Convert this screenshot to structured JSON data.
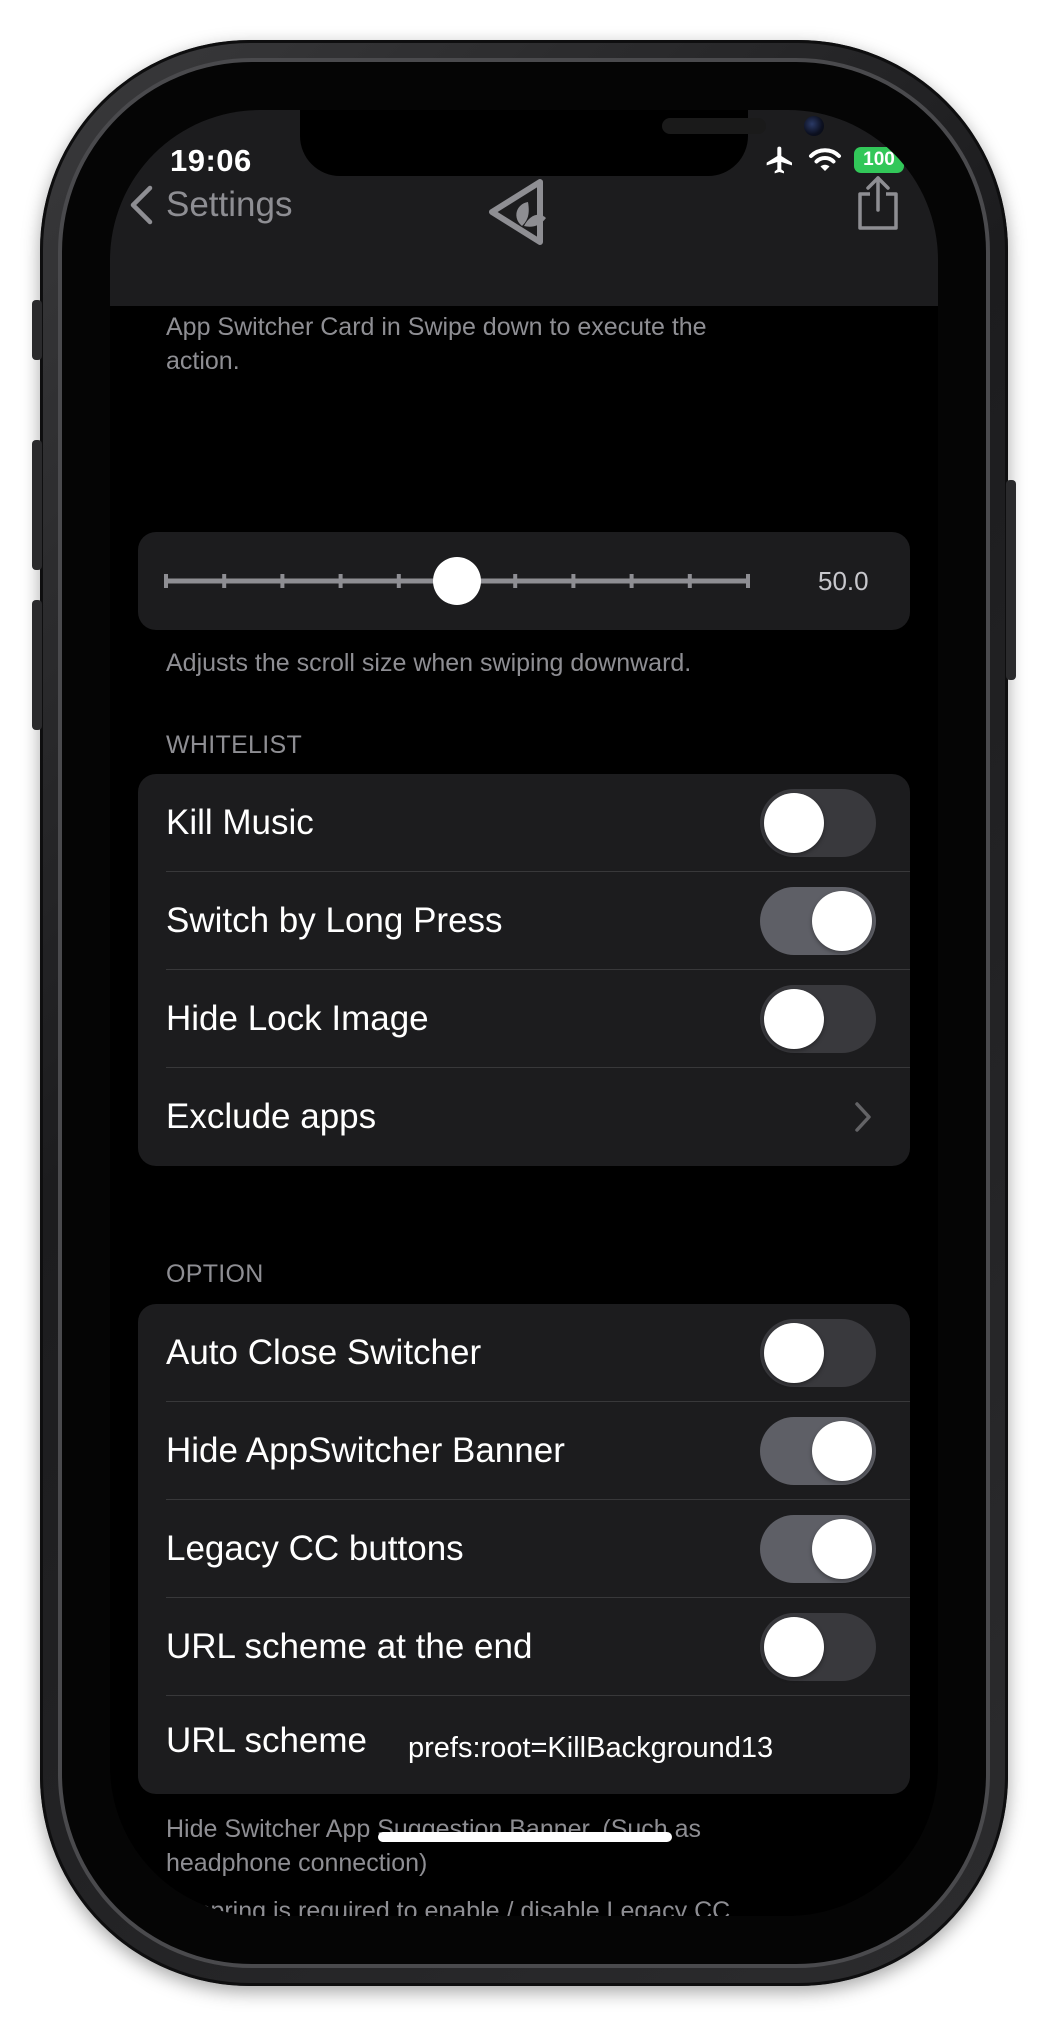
{
  "status_bar": {
    "time": "19:06",
    "battery": "100"
  },
  "nav": {
    "back_label": "Settings"
  },
  "top_footer": "App Switcher Card in Swipe down to execute the action.",
  "slider": {
    "value_label": "50.0",
    "fraction": 0.5,
    "ticks": 11
  },
  "slider_footer": "Adjusts the scroll size when swiping downward.",
  "whitelist": {
    "header": "WHITELIST",
    "rows": [
      {
        "label": "Kill Music",
        "on": false
      },
      {
        "label": "Switch by Long Press",
        "on": true
      },
      {
        "label": "Hide Lock Image",
        "on": false
      }
    ],
    "exclude_label": "Exclude apps"
  },
  "option": {
    "header": "OPTION",
    "rows": [
      {
        "label": "Auto Close Switcher",
        "on": false
      },
      {
        "label": "Hide AppSwitcher Banner",
        "on": true
      },
      {
        "label": "Legacy CC buttons",
        "on": true
      },
      {
        "label": "URL scheme at the end",
        "on": false
      }
    ],
    "url_scheme_label": "URL scheme",
    "url_scheme_value": "prefs:root=KillBackground13"
  },
  "footer_1": "Hide Switcher App Suggestion Banner. (Such as headphone connection)",
  "footer_2": "Respring is required to enable / disable Legacy CC buttons."
}
